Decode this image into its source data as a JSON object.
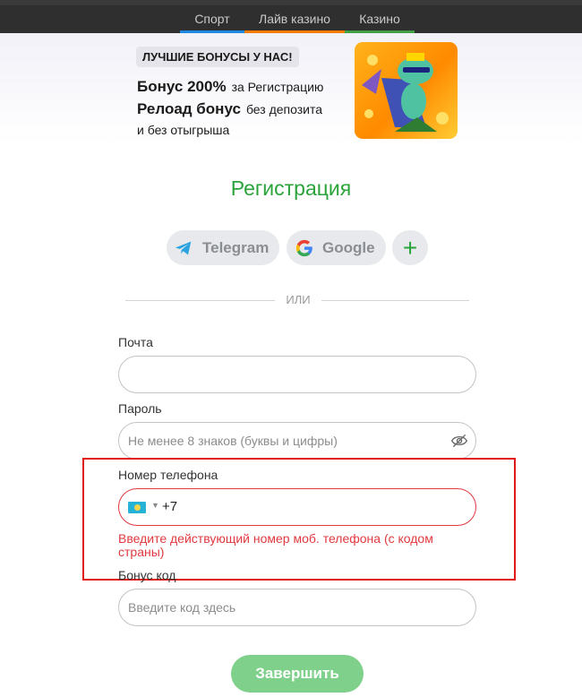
{
  "nav": {
    "tabs": [
      {
        "label": "Спорт",
        "color": "#1e88e5"
      },
      {
        "label": "Лайв казино",
        "color": "#f57c00"
      },
      {
        "label": "Казино",
        "color": "#43a047"
      }
    ]
  },
  "promo": {
    "badge": "ЛУЧШИЕ БОНУСЫ У НАС!",
    "line1_bold": "Бонус 200%",
    "line1_rest": "за Регистрацию",
    "line2_bold": "Релоад бонус",
    "line2_rest": "без депозита",
    "line3": "и без отыгрыша"
  },
  "form": {
    "title": "Регистрация",
    "social": {
      "telegram": "Telegram",
      "google": "Google",
      "more": "+"
    },
    "divider": "ИЛИ",
    "email": {
      "label": "Почта",
      "value": "",
      "placeholder": ""
    },
    "password": {
      "label": "Пароль",
      "placeholder": "Не менее 8 знаков (буквы и цифры)"
    },
    "phone": {
      "label": "Номер телефона",
      "code": "+7",
      "flag": "kazakhstan-flag",
      "error": "Введите действующий номер моб. телефона (с кодом страны)"
    },
    "bonus": {
      "label": "Бонус код",
      "placeholder": "Введите код здесь"
    },
    "submit": "Завершить"
  },
  "colors": {
    "accent": "#2aa33b",
    "error": "#e1393f",
    "highlight_box": "#e01818",
    "submit_bg": "#7fd08b"
  }
}
